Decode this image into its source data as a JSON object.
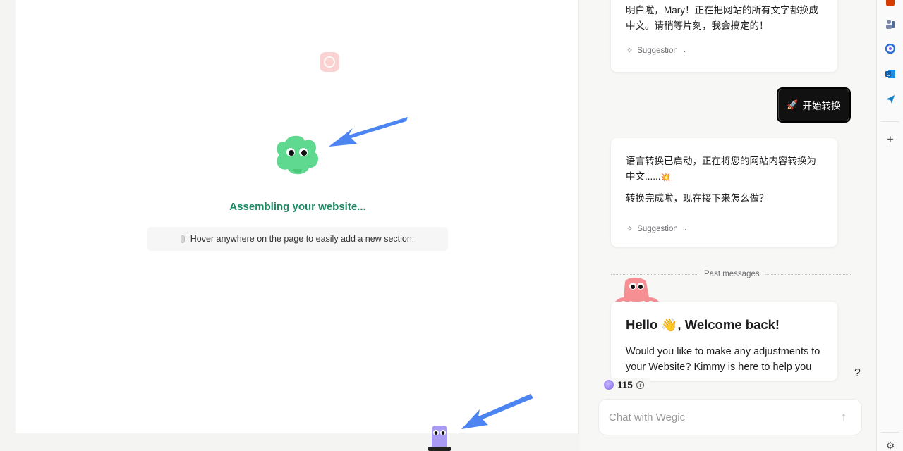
{
  "canvas": {
    "status_text": "Assembling your website...",
    "hint_text": "Hover anywhere on the page to easily add a new section."
  },
  "chat": {
    "messages": [
      {
        "lines": [
          "明白啦，Mary！正在把网站的所有文字都换成",
          "中文。请稍等片刻，我会搞定的！"
        ],
        "suggestion_label": "Suggestion"
      },
      {
        "lines": [
          "语言转换已启动，正在将您的网站内容转换为",
          "中文......"
        ],
        "line2": "转换完成啦，现在接下来怎么做？",
        "emoji": "💥",
        "suggestion_label": "Suggestion"
      }
    ],
    "start_button": "开始转换",
    "past_messages_label": "Past messages",
    "welcome": {
      "title_prefix": "Hello ",
      "wave_emoji": "👋",
      "title_suffix": ", Welcome back!",
      "body": "Would you like to make any adjustments to your Website? Kimmy is here to help you"
    },
    "credits": "115",
    "help_label": "?",
    "input_placeholder": "Chat with Wegic"
  },
  "sidebar": {
    "icons": [
      "office-icon",
      "people-icon",
      "copilot-icon",
      "copilot-shape-icon",
      "outlook-icon",
      "send-icon",
      "add-icon",
      "settings-icon"
    ],
    "add_glyph": "+",
    "settings_glyph": "⚙"
  },
  "colors": {
    "accent_green": "#1d8a63",
    "arrow_blue": "#4c84f2",
    "start_button_bg": "#111111"
  }
}
